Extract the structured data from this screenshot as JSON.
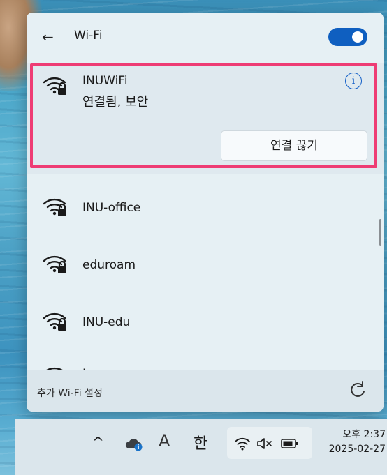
{
  "wifi_panel": {
    "back_label": "←",
    "title": "Wi-Fi",
    "toggle_on": true,
    "connected_network": {
      "name": "INUWiFi",
      "status": "연결됨, 보안",
      "info_label": "i",
      "disconnect_label": "연결 끊기"
    },
    "networks": [
      {
        "name": "INU-office"
      },
      {
        "name": "eduroam"
      },
      {
        "name": "INU-edu"
      },
      {
        "name": "I"
      }
    ],
    "footer": {
      "more_settings_label": "추가 Wi-Fi 설정"
    },
    "accent_color": "#0f5fc0",
    "highlight_color": "#ee3c74"
  },
  "taskbar": {
    "chevron": "^",
    "ime_mode": "A",
    "ime_lang": "한",
    "clock_time": "오후 2:37",
    "clock_date": "2025-02-27"
  }
}
